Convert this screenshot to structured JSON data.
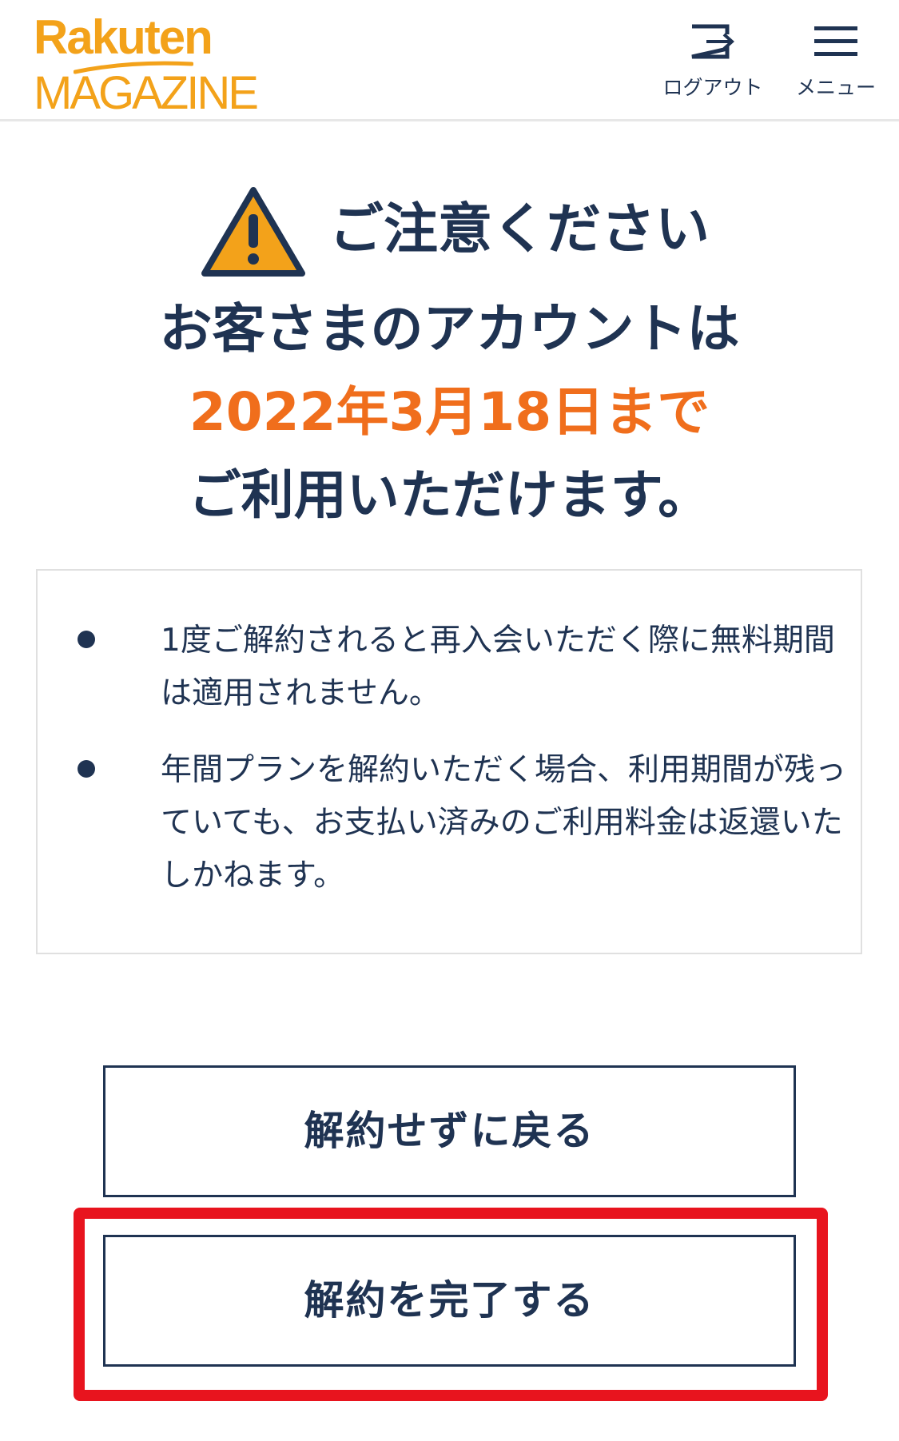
{
  "header": {
    "logo_top": "Rakuten",
    "logo_bottom": "MAGAZINE",
    "logout_label": "ログアウト",
    "logout_icon": "logout-icon",
    "menu_label": "メニュー",
    "menu_icon": "hamburger-menu-icon"
  },
  "warning": {
    "icon": "warning-triangle-icon",
    "title": "ご注意ください",
    "line1": "お客さまのアカウントは",
    "line2": "2022年3月18日まで",
    "line3": "ご利用いただけます。"
  },
  "notes": [
    "1度ご解約されると再入会いただく際に無料期間は適用されません。",
    "年間プランを解約いただく場合、利用期間が残っていても、お支払い済みのご利用料金は返還いたしかねます。"
  ],
  "buttons": {
    "back_label": "解約せずに戻る",
    "complete_label": "解約を完了する"
  },
  "colors": {
    "brand_orange": "#f3a21a",
    "text_navy": "#1f3352",
    "date_orange": "#f06e1c",
    "highlight_red": "#e8141e"
  }
}
